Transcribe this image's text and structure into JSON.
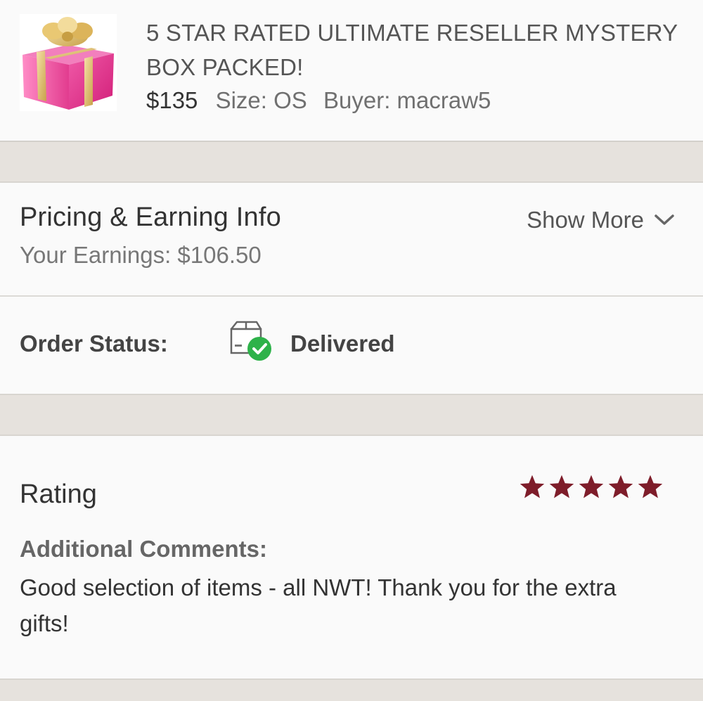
{
  "item": {
    "title": "5 STAR RATED ULTIMATE RESELLER MYSTERY BOX PACKED!",
    "price": "$135",
    "size": "Size: OS",
    "buyer": "Buyer: macraw5",
    "image_icon": "gift-box-image"
  },
  "pricing": {
    "title": "Pricing & Earning Info",
    "earnings": "Your Earnings: $106.50",
    "show_more_label": "Show More"
  },
  "order_status": {
    "label": "Order Status:",
    "value": "Delivered",
    "icon": "delivered-box-icon",
    "check_color": "#2eb24a"
  },
  "rating": {
    "title": "Rating",
    "stars": 5,
    "max_stars": 5,
    "star_color": "#7e1d2a",
    "comments_label": "Additional Comments:",
    "comments_text": "Good selection of items - all NWT! Thank you for the extra gifts!"
  }
}
